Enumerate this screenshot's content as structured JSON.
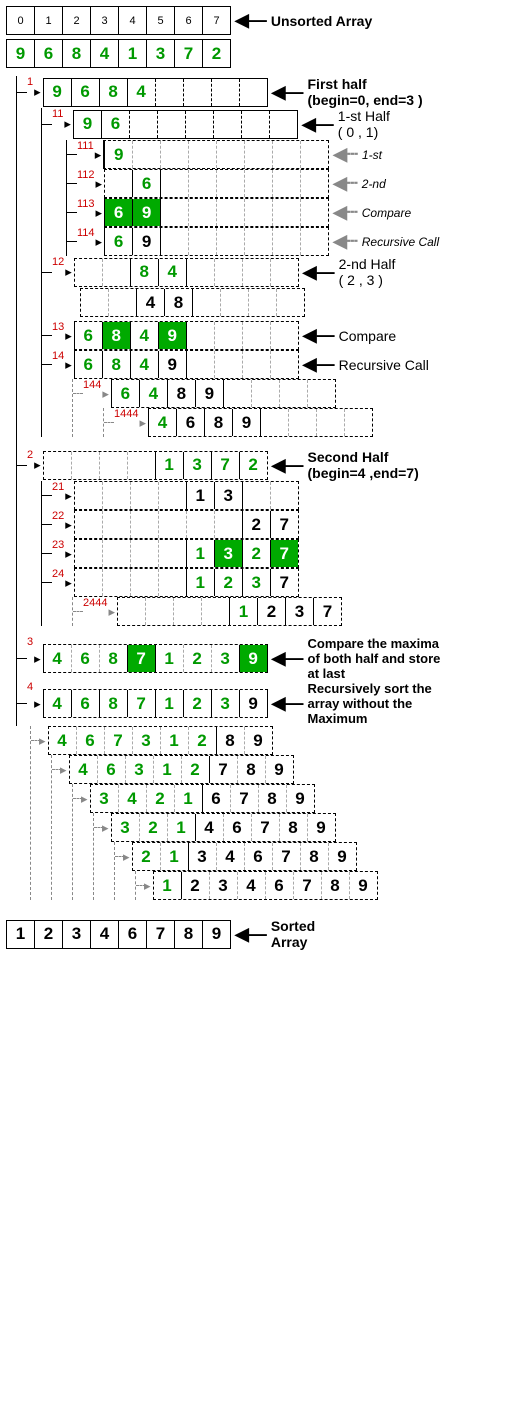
{
  "indices": [
    "0",
    "1",
    "2",
    "3",
    "4",
    "5",
    "6",
    "7"
  ],
  "unsorted": [
    "9",
    "6",
    "8",
    "4",
    "1",
    "3",
    "7",
    "2"
  ],
  "labels": {
    "unsorted": "Unsorted Array",
    "firstHalf_l1": "First half",
    "firstHalf_l2": "(begin=0, end=3 )",
    "h11_l1": "1-st Half",
    "h11_l2": "( 0 , 1)",
    "s111": "1-st",
    "s112": "2-nd",
    "s113": "Compare",
    "s114": "Recursive Call",
    "h12_l1": "2-nd Half",
    "h12_l2": "( 2 , 3 )",
    "s13": "Compare",
    "s14": "Recursive Call",
    "second_l1": "Second Half",
    "second_l2": "(begin=4 ,end=7)",
    "cmp_l1": "Compare the maxima",
    "cmp_l2": "of both half and store",
    "cmp_l3": "at last",
    "rec_l1": "Recursively sort the",
    "rec_l2": "array without the",
    "rec_l3": "Maximum",
    "sorted_l1": "Sorted",
    "sorted_l2": "Array"
  },
  "steps": {
    "s1": "1",
    "s11": "11",
    "s111": "111",
    "s112": "112",
    "s113": "113",
    "s114": "114",
    "s12": "12",
    "s13": "13",
    "s14": "14",
    "s144": "144",
    "s1444": "1444",
    "s2": "2",
    "s21": "21",
    "s22": "22",
    "s23": "23",
    "s24": "24",
    "s2444": "2444",
    "s3": "3",
    "s4": "4"
  },
  "rows": {
    "r1": [
      "9",
      "6",
      "8",
      "4",
      "",
      "",
      "",
      ""
    ],
    "r11": [
      "9",
      "6",
      "",
      "",
      "",
      "",
      "",
      ""
    ],
    "r111": [
      "9",
      "",
      "",
      "",
      "",
      "",
      "",
      ""
    ],
    "r112": [
      "",
      "6",
      "",
      "",
      "",
      "",
      "",
      ""
    ],
    "r113": [
      "6",
      "9",
      "",
      "",
      "",
      "",
      "",
      ""
    ],
    "r114": [
      "6",
      "9",
      "",
      "",
      "",
      "",
      "",
      ""
    ],
    "r12": [
      "",
      "",
      "8",
      "4",
      "",
      "",
      "",
      ""
    ],
    "r12b": [
      "",
      "",
      "4",
      "8",
      "",
      "",
      "",
      ""
    ],
    "r13": [
      "6",
      "8",
      "4",
      "9",
      "",
      "",
      "",
      ""
    ],
    "r14": [
      "6",
      "8",
      "4",
      "9",
      "",
      "",
      "",
      ""
    ],
    "r144": [
      "6",
      "4",
      "8",
      "9",
      "",
      "",
      "",
      ""
    ],
    "r1444": [
      "4",
      "6",
      "8",
      "9",
      "",
      "",
      "",
      ""
    ],
    "r2": [
      "",
      "",
      "",
      "",
      "1",
      "3",
      "7",
      "2"
    ],
    "r21": [
      "",
      "",
      "",
      "",
      "1",
      "3",
      "",
      ""
    ],
    "r22": [
      "",
      "",
      "",
      "",
      "",
      "",
      "2",
      "7"
    ],
    "r23": [
      "",
      "",
      "",
      "",
      "1",
      "3",
      "2",
      "7"
    ],
    "r24": [
      "",
      "",
      "",
      "",
      "1",
      "2",
      "3",
      "7"
    ],
    "r2444": [
      "",
      "",
      "",
      "",
      "1",
      "2",
      "3",
      "7"
    ],
    "r3": [
      "4",
      "6",
      "8",
      "7",
      "1",
      "2",
      "3",
      "9"
    ],
    "r4": [
      "4",
      "6",
      "8",
      "7",
      "1",
      "2",
      "3",
      "9"
    ],
    "r4a": [
      "4",
      "6",
      "7",
      "3",
      "1",
      "2",
      "8",
      "9"
    ],
    "r4b": [
      "4",
      "6",
      "3",
      "1",
      "2",
      "7",
      "8",
      "9"
    ],
    "r4c": [
      "3",
      "4",
      "2",
      "1",
      "6",
      "7",
      "8",
      "9"
    ],
    "r4d": [
      "3",
      "2",
      "1",
      "4",
      "6",
      "7",
      "8",
      "9"
    ],
    "r4e": [
      "2",
      "1",
      "3",
      "4",
      "6",
      "7",
      "8",
      "9"
    ],
    "r4f": [
      "1",
      "2",
      "3",
      "4",
      "6",
      "7",
      "8",
      "9"
    ]
  },
  "sorted": [
    "1",
    "2",
    "3",
    "4",
    "6",
    "7",
    "8",
    "9"
  ]
}
